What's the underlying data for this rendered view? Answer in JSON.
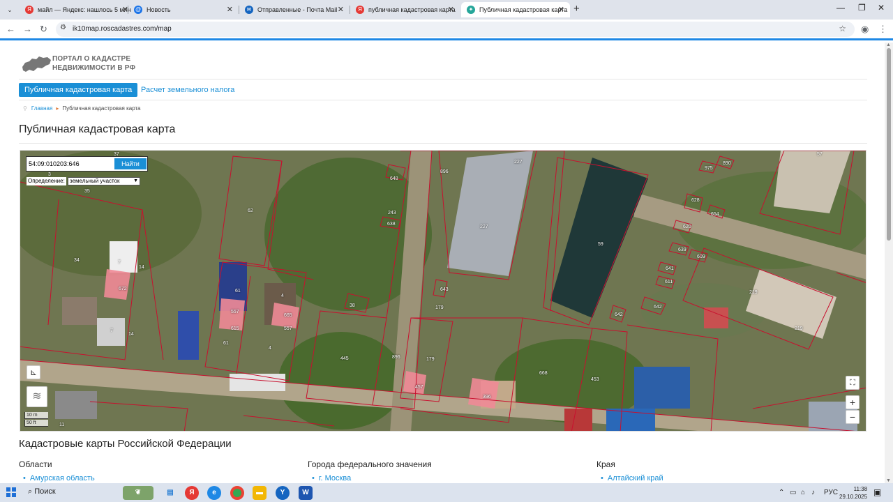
{
  "browser": {
    "tabs": [
      {
        "title": "майл — Яндекс: нашлось 5 млн",
        "icon": "yandex-icon",
        "color": "#e53935"
      },
      {
        "title": "Новость",
        "icon": "globe-icon",
        "color": "#1a73e8"
      },
      {
        "title": "Отправленные - Почта Mail",
        "icon": "mail-icon",
        "color": "#1565c0"
      },
      {
        "title": "публичная кадастровая карта",
        "icon": "yandex-icon",
        "color": "#e53935"
      },
      {
        "title": "Публичная кадастровая карта",
        "icon": "map-icon",
        "color": "#26a69a"
      }
    ],
    "url": "ik10map.roscadastres.com/map"
  },
  "site": {
    "logo_line1": "ПОРТАЛ О КАДАСТРЕ",
    "logo_line2": "НЕДВИЖИМОСТИ В РФ",
    "menu": [
      "Публичная кадастровая карта",
      "Расчет земельного налога"
    ],
    "breadcrumb": {
      "home": "Главная",
      "current": "Публичная кадастровая карта"
    },
    "title": "Публичная кадастровая карта"
  },
  "map": {
    "search_value": "54:09:010203:646",
    "search_button": "Найти",
    "type_label": "Определение:",
    "type_selected": "земельный участок",
    "scale_m": "10 m",
    "scale_ft": "50 ft",
    "zoom_in": "+",
    "zoom_out": "−",
    "parcel_labels": [
      "37",
      "3",
      "35",
      "648",
      "896",
      "227",
      "975",
      "890",
      "57",
      "62",
      "243",
      "638",
      "628",
      "654",
      "620",
      "227",
      "59",
      "639",
      "609",
      "34",
      "7",
      "14",
      "672",
      "641",
      "611",
      "61",
      "4",
      "38",
      "643",
      "179",
      "219",
      "557",
      "665",
      "615",
      "557",
      "642",
      "642",
      "219",
      "61",
      "4",
      "7",
      "14",
      "445",
      "896",
      "179",
      "668",
      "453",
      "457",
      "396",
      "11"
    ]
  },
  "regions": {
    "title": "Кадастровые карты Российской Федерации",
    "columns": [
      {
        "title": "Области",
        "first_item": "Амурская область"
      },
      {
        "title": "Города федерального значения",
        "first_item": "г. Москва"
      },
      {
        "title": "Края",
        "first_item": "Алтайский край"
      }
    ]
  },
  "taskbar": {
    "search_label": "Поиск",
    "lang": "РУС",
    "time": "11:38",
    "date": "29.10.2025"
  }
}
